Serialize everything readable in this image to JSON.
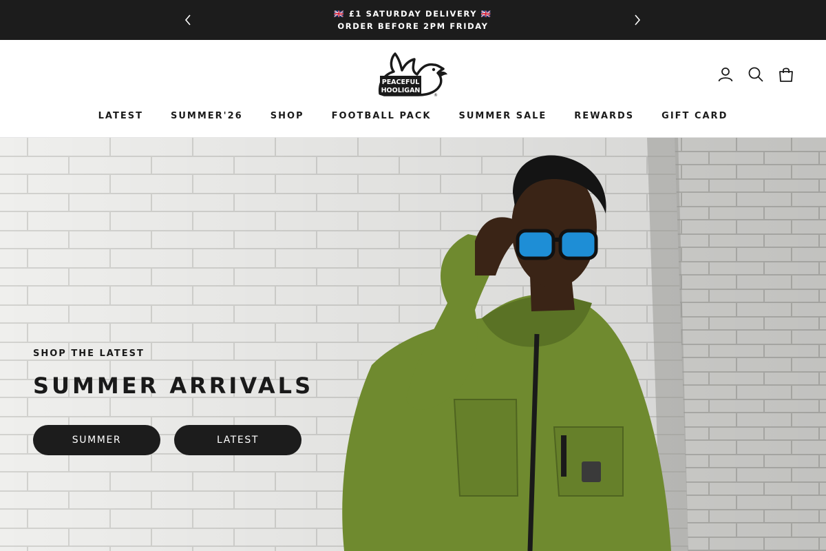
{
  "announcement": {
    "line1": "🇬🇧 £1 SATURDAY DELIVERY 🇬🇧",
    "line2": "ORDER BEFORE 2PM FRIDAY",
    "prev_icon": "chevron-left-icon",
    "next_icon": "chevron-right-icon",
    "bg_color": "#1c1c1c"
  },
  "header": {
    "logo": {
      "line1": "PEACEFUL",
      "line2": "HOOLIGAN"
    },
    "icons": [
      "account-icon",
      "search-icon",
      "cart-bag-icon"
    ],
    "nav": [
      {
        "label": "LATEST"
      },
      {
        "label": "SUMMER'26"
      },
      {
        "label": "SHOP"
      },
      {
        "label": "FOOTBALL PACK"
      },
      {
        "label": "SUMMER SALE"
      },
      {
        "label": "REWARDS"
      },
      {
        "label": "GIFT CARD"
      }
    ]
  },
  "hero": {
    "kicker": "SHOP THE LATEST",
    "title": "SUMMER ARRIVALS",
    "buttons": [
      {
        "label": "SUMMER"
      },
      {
        "label": "LATEST"
      }
    ],
    "jacket_color": "#6f8a2f",
    "wall_color": "#eeeeec"
  }
}
